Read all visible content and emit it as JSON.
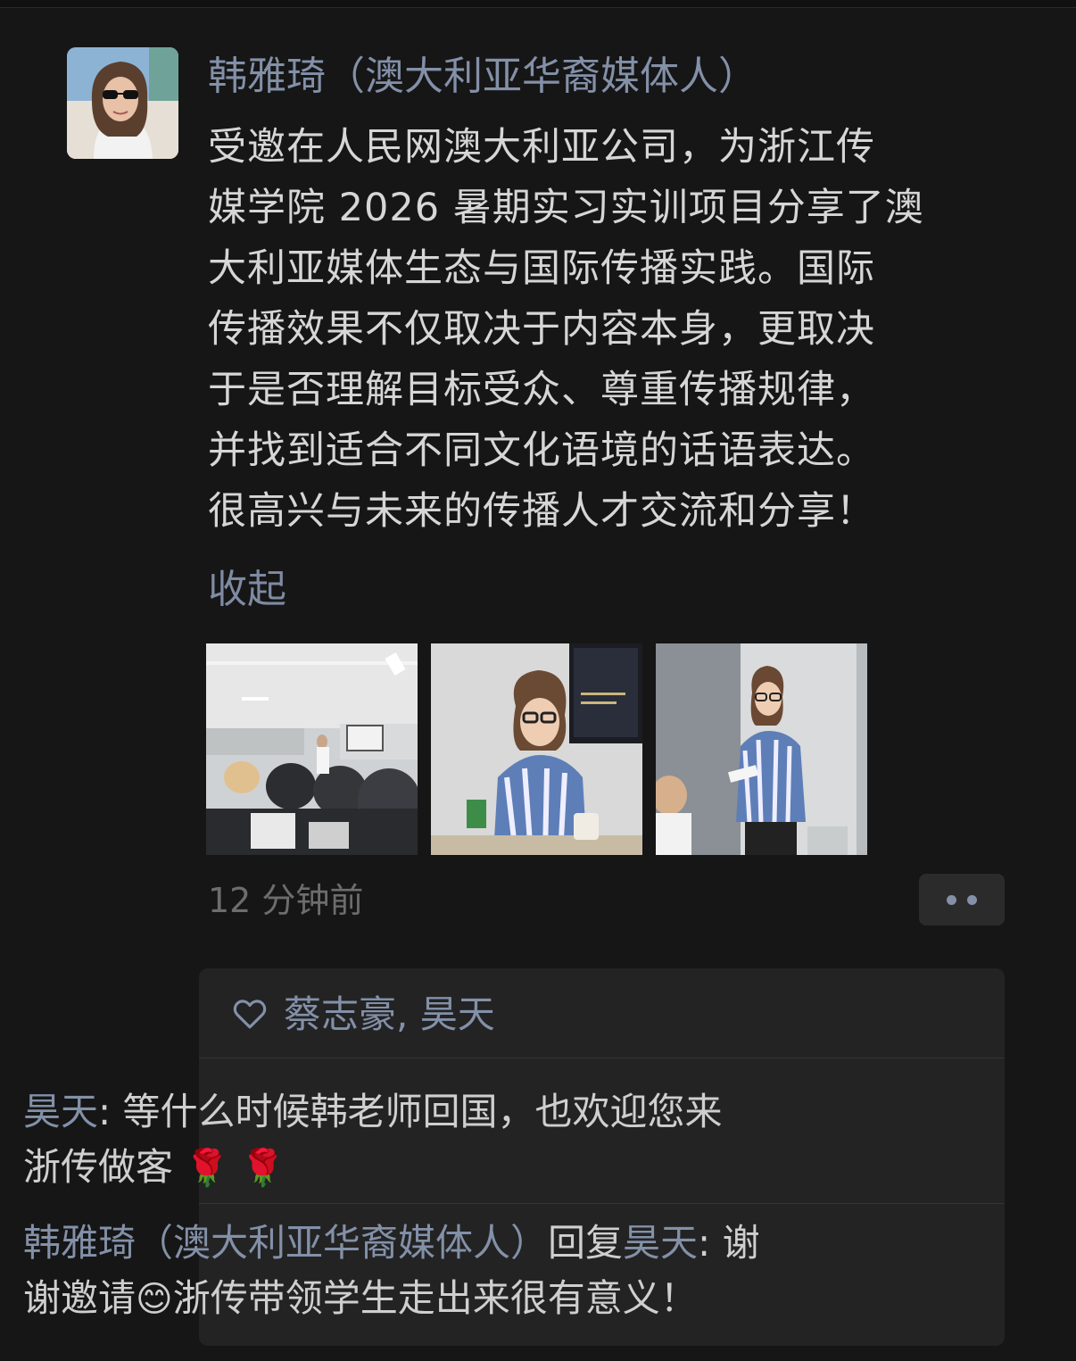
{
  "post": {
    "author": "韩雅琦（澳大利亚华裔媒体人）",
    "content_lines": [
      "受邀在人民网澳大利亚公司，为浙江传",
      "媒学院 2026 暑期实习实训项目分享了澳",
      "大利亚媒体生态与国际传播实践。国际",
      "传播效果不仅取决于内容本身，更取决",
      "于是否理解目标受众、尊重传播规律，",
      "并找到适合不同文化语境的话语表达。",
      "很高兴与未来的传播人才交流和分享！"
    ],
    "collapse_label": "收起",
    "photo_count": 3,
    "time": "12 分钟前",
    "more_icon": "ellipsis-icon"
  },
  "likes": {
    "icon": "heart-icon",
    "names": "蔡志豪, 昊天"
  },
  "comments": [
    {
      "author": "昊天",
      "sep": ": ",
      "line1": "等什么时候韩老师回国，也欢迎您来",
      "line2": "浙传做客",
      "emoji": "🌹 🌹"
    },
    {
      "author": "韩雅琦（澳大利亚华裔媒体人）",
      "reply_word": "回复",
      "reply_to": "昊天",
      "sep": ": ",
      "line1_tail": "谢",
      "line2_head": "谢邀请",
      "emoji": "😊",
      "line2_tail": "浙传带领学生走出来很有意义！"
    }
  ],
  "colors": {
    "background": "#161616",
    "name_link": "#8390a8",
    "body_text": "#d6d6d6",
    "panel": "#232323"
  }
}
